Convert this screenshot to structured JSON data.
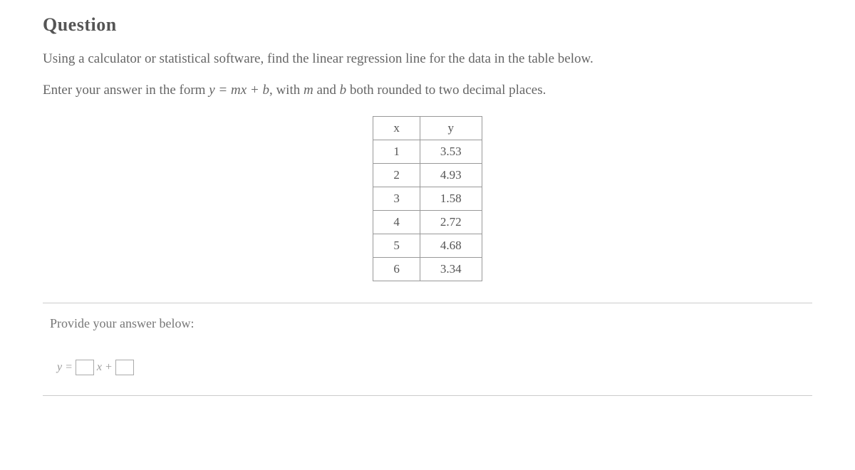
{
  "heading": "Question",
  "prompt1": "Using a calculator or statistical software, find the linear regression line for the data in the table below.",
  "prompt2_pre": "Enter your answer in the form ",
  "prompt2_eq": "y = mx + b",
  "prompt2_mid": ", with ",
  "prompt2_m": "m",
  "prompt2_and": " and ",
  "prompt2_b": "b",
  "prompt2_post": " both rounded to two decimal places.",
  "table": {
    "headers": {
      "x": "x",
      "y": "y"
    },
    "rows": [
      {
        "x": "1",
        "y": "3.53"
      },
      {
        "x": "2",
        "y": "4.93"
      },
      {
        "x": "3",
        "y": "1.58"
      },
      {
        "x": "4",
        "y": "2.72"
      },
      {
        "x": "5",
        "y": "4.68"
      },
      {
        "x": "6",
        "y": "3.34"
      }
    ]
  },
  "answer_label": "Provide your answer below:",
  "equation": {
    "y": "y",
    "eq": "=",
    "x": "x",
    "plus": "+"
  }
}
